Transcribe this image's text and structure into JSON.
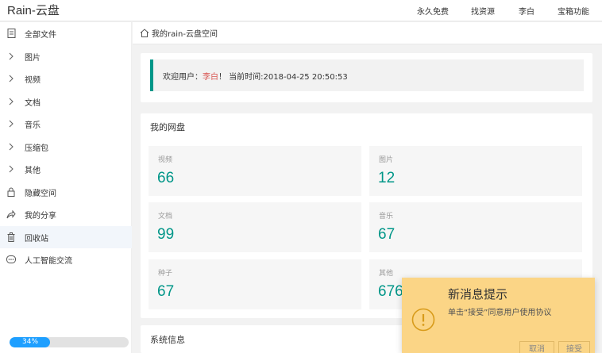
{
  "header": {
    "logo": "Rain-云盘",
    "links": [
      "永久免费",
      "找资源",
      "李白",
      "宝箱功能"
    ]
  },
  "sidebar": {
    "items": [
      {
        "label": "全部文件",
        "icon": "file-icon"
      },
      {
        "label": "图片",
        "icon": "chevron-right-icon"
      },
      {
        "label": "视频",
        "icon": "chevron-right-icon"
      },
      {
        "label": "文档",
        "icon": "chevron-right-icon"
      },
      {
        "label": "音乐",
        "icon": "chevron-right-icon"
      },
      {
        "label": "压缩包",
        "icon": "chevron-right-icon"
      },
      {
        "label": "其他",
        "icon": "chevron-right-icon"
      },
      {
        "label": "隐藏空间",
        "icon": "lock-icon"
      },
      {
        "label": "我的分享",
        "icon": "share-icon"
      },
      {
        "label": "回收站",
        "icon": "trash-icon"
      },
      {
        "label": "人工智能交流",
        "icon": "chat-icon"
      }
    ],
    "storage_progress": {
      "percent": 34,
      "label": "34%"
    }
  },
  "breadcrumb": {
    "text": "我的rain-云盘空间"
  },
  "welcome": {
    "prefix": "欢迎用户：",
    "user": "李白",
    "suffix": "！ 当前时间:2018-04-25 20:50:53"
  },
  "disk": {
    "title": "我的网盘",
    "stats": [
      {
        "label": "视频",
        "value": "66"
      },
      {
        "label": "图片",
        "value": "12"
      },
      {
        "label": "文档",
        "value": "99"
      },
      {
        "label": "音乐",
        "value": "67"
      },
      {
        "label": "种子",
        "value": "67"
      },
      {
        "label": "其他",
        "value": "676"
      }
    ]
  },
  "system": {
    "title": "系统信息"
  },
  "popup": {
    "title": "新消息提示",
    "message": "单击“接受”同意用户使用协议",
    "cancel": "取消",
    "accept": "接受"
  },
  "colors": {
    "accent": "#009688",
    "progress": "#1e9fff",
    "popup_bg": "#fbd586",
    "user_highlight": "#d9534f"
  }
}
